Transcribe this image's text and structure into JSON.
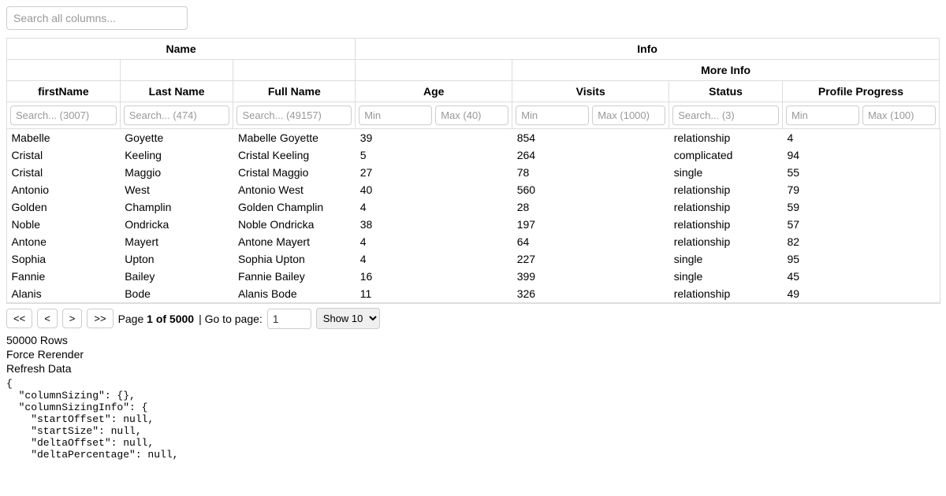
{
  "globalSearch": {
    "placeholder": "Search all columns..."
  },
  "headers": {
    "group_name": "Name",
    "group_info": "Info",
    "group_more_info": "More Info",
    "firstName": "firstName",
    "lastName": "Last Name",
    "fullName": "Full Name",
    "age": "Age",
    "visits": "Visits",
    "status": "Status",
    "profileProgress": "Profile Progress"
  },
  "filters": {
    "firstName_ph": "Search... (3007)",
    "lastName_ph": "Search... (474)",
    "fullName_ph": "Search... (49157)",
    "age_min_ph": "Min",
    "age_max_ph": "Max (40)",
    "visits_min_ph": "Min",
    "visits_max_ph": "Max (1000)",
    "status_ph": "Search... (3)",
    "pp_min_ph": "Min",
    "pp_max_ph": "Max (100)"
  },
  "rows": [
    {
      "firstName": "Mabelle",
      "lastName": "Goyette",
      "fullName": "Mabelle Goyette",
      "age": "39",
      "visits": "854",
      "status": "relationship",
      "pp": "4"
    },
    {
      "firstName": "Cristal",
      "lastName": "Keeling",
      "fullName": "Cristal Keeling",
      "age": "5",
      "visits": "264",
      "status": "complicated",
      "pp": "94"
    },
    {
      "firstName": "Cristal",
      "lastName": "Maggio",
      "fullName": "Cristal Maggio",
      "age": "27",
      "visits": "78",
      "status": "single",
      "pp": "55"
    },
    {
      "firstName": "Antonio",
      "lastName": "West",
      "fullName": "Antonio West",
      "age": "40",
      "visits": "560",
      "status": "relationship",
      "pp": "79"
    },
    {
      "firstName": "Golden",
      "lastName": "Champlin",
      "fullName": "Golden Champlin",
      "age": "4",
      "visits": "28",
      "status": "relationship",
      "pp": "59"
    },
    {
      "firstName": "Noble",
      "lastName": "Ondricka",
      "fullName": "Noble Ondricka",
      "age": "38",
      "visits": "197",
      "status": "relationship",
      "pp": "57"
    },
    {
      "firstName": "Antone",
      "lastName": "Mayert",
      "fullName": "Antone Mayert",
      "age": "4",
      "visits": "64",
      "status": "relationship",
      "pp": "82"
    },
    {
      "firstName": "Sophia",
      "lastName": "Upton",
      "fullName": "Sophia Upton",
      "age": "4",
      "visits": "227",
      "status": "single",
      "pp": "95"
    },
    {
      "firstName": "Fannie",
      "lastName": "Bailey",
      "fullName": "Fannie Bailey",
      "age": "16",
      "visits": "399",
      "status": "single",
      "pp": "45"
    },
    {
      "firstName": "Alanis",
      "lastName": "Bode",
      "fullName": "Alanis Bode",
      "age": "11",
      "visits": "326",
      "status": "relationship",
      "pp": "49"
    }
  ],
  "pagination": {
    "first": "<<",
    "prev": "<",
    "next": ">",
    "last": ">>",
    "page_label_prefix": "Page ",
    "page_current_bold": "1 of 5000",
    "goto_label": " | Go to page: ",
    "goto_value": "1",
    "pagesize_prefix": "Show ",
    "pagesize_value": "10"
  },
  "footer": {
    "rows_label": "50000 Rows",
    "force_rerender": "Force Rerender",
    "refresh_data": "Refresh Data"
  },
  "state_json": "{\n  \"columnSizing\": {},\n  \"columnSizingInfo\": {\n    \"startOffset\": null,\n    \"startSize\": null,\n    \"deltaOffset\": null,\n    \"deltaPercentage\": null,"
}
